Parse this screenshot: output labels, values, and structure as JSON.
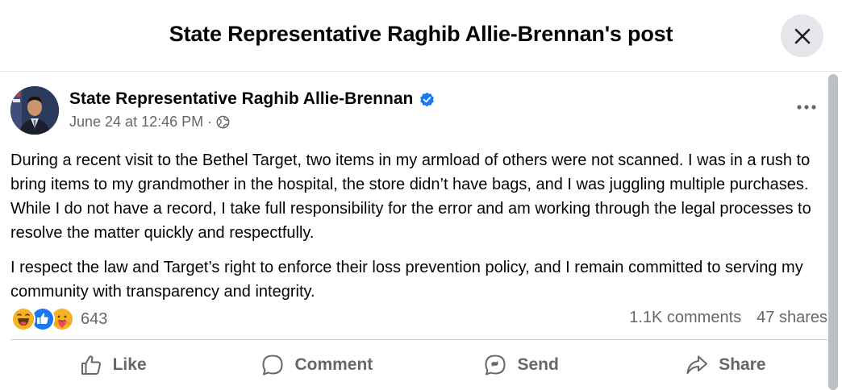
{
  "modal": {
    "title": "State Representative Raghib Allie-Brennan's post"
  },
  "post": {
    "author": "State Representative Raghib Allie-Brennan",
    "timestamp": "June 24 at 12:46 PM",
    "separator": "·",
    "paragraphs": [
      "During a recent visit to the Bethel Target, two items in my armload of others were not scanned. I was in a rush to bring items to my grandmother in the hospital, the store didn’t have bags, and I was juggling multiple purchases. While I do not have a record, I take full responsibility for the error and am working through the legal processes to resolve the matter quickly and respectfully.",
      "I respect the law and Target’s right to enforce their loss prevention policy, and I remain committed to serving my community with transparency and integrity."
    ],
    "reactions": {
      "icons": [
        "haha-icon",
        "like-icon",
        "care-icon"
      ],
      "count": "643"
    },
    "comments": "1.1K comments",
    "shares": "47 shares"
  },
  "actions": {
    "like": "Like",
    "comment": "Comment",
    "send": "Send",
    "share": "Share"
  },
  "colors": {
    "verified": "#1877f2",
    "secondary_text": "#65676b",
    "like_blue": "#1877f2",
    "haha_yellow": "#f7b125"
  }
}
